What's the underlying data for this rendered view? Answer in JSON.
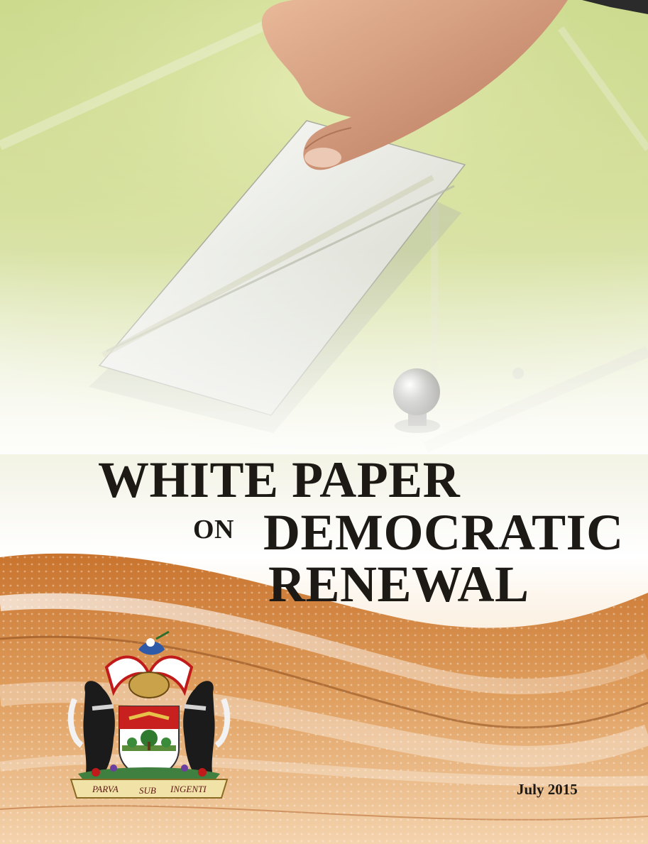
{
  "title": {
    "line1": "WHITE PAPER",
    "on": "ON",
    "line2": "DEMOCRATIC",
    "line3": "RENEWAL"
  },
  "date": "July 2015",
  "crest": {
    "motto": [
      "PARVA",
      "SUB",
      "INGENTI"
    ]
  },
  "colors": {
    "green_top": "#c9d98a",
    "cream": "#f7f6ee",
    "orange": "#d88a3a",
    "title_text": "#1d1a16"
  },
  "icons": {
    "photo": "ballot-hand-image",
    "crest": "coat-of-arms-icon"
  }
}
